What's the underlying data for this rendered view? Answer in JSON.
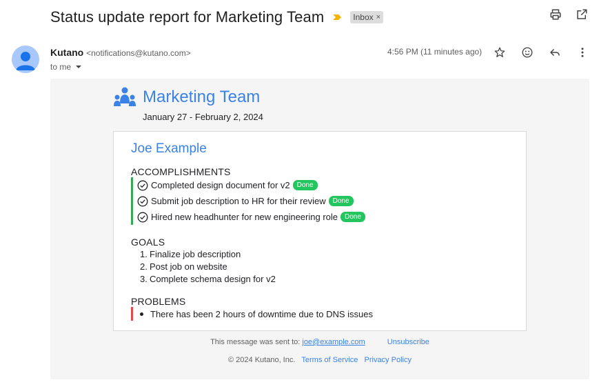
{
  "subject": "Status update report for Marketing Team",
  "label": {
    "text": "Inbox",
    "remove": "×"
  },
  "sender": {
    "name": "Kutano",
    "email": "<notifications@kutano.com>",
    "to": "to me"
  },
  "timestamp": "4:56 PM (11 minutes ago)",
  "icons": {
    "print": "print-icon",
    "open_new": "open-in-new-icon",
    "star": "star-icon",
    "emoji": "emoji-icon",
    "reply": "reply-icon",
    "more": "more-vert-icon"
  },
  "colors": {
    "accent": "#3b82e6",
    "done": "#22c55e",
    "accomplishment_bar": "#34a853",
    "problem_bar": "#e5484d"
  },
  "report": {
    "team": "Marketing Team",
    "dates": "January 27 - February 2, 2024",
    "person": "Joe Example",
    "accomplishments_title": "ACCOMPLISHMENTS",
    "accomplishments": [
      {
        "text": "Completed design document for v2",
        "status": "Done"
      },
      {
        "text": "Submit job description to HR for their review",
        "status": "Done"
      },
      {
        "text": "Hired new headhunter for new engineering role",
        "status": "Done"
      }
    ],
    "goals_title": "GOALS",
    "goals": [
      {
        "num": "1.",
        "text": "Finalize job description"
      },
      {
        "num": "2.",
        "text": "Post job on website"
      },
      {
        "num": "3.",
        "text": "Complete schema design for v2"
      }
    ],
    "problems_title": "PROBLEMS",
    "problems": [
      "There has been 2 hours of downtime due to DNS issues"
    ]
  },
  "footer": {
    "sent_to_label": "This message was sent to:",
    "sent_to_email": "joe@example.com",
    "unsubscribe": "Unsubscribe",
    "copyright": "© 2024 Kutano, Inc.",
    "terms": "Terms of Service",
    "privacy": "Privacy Policy"
  }
}
